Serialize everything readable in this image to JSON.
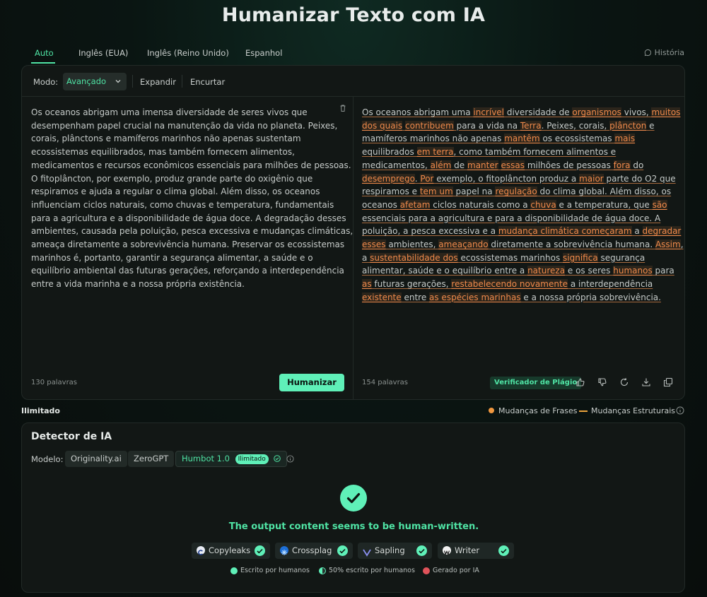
{
  "page": {
    "title": "Humanizar Texto com IA"
  },
  "tabs": [
    {
      "label": "Auto",
      "active": true
    },
    {
      "label": "Inglês (EUA)"
    },
    {
      "label": "Inglês (Reino Unido)"
    },
    {
      "label": "Espanhol"
    }
  ],
  "history_label": "História",
  "toolbar": {
    "mode_label": "Modo:",
    "mode_value": "Avançado",
    "expand_label": "Expandir",
    "shorten_label": "Encurtar"
  },
  "input": {
    "lines": [
      "Os oceanos abrigam uma imensa diversidade de seres vivos que",
      "desempenham papel crucial na manutenção da vida no planeta. Peixes,",
      "corais, plânctons e mamíferos marinhos não apenas sustentam",
      "ecossistemas equilibrados, mas também fornecem alimentos,",
      "medicamentos e recursos econômicos essenciais para milhões de pessoas.",
      "O fitoplâncton, por exemplo, produz grande parte do oxigênio que",
      "respiramos e ajuda a regular o clima global. Além disso, os oceanos",
      "influenciam ciclos naturais, como chuvas e temperatura, fundamentais",
      "para a agricultura e a disponibilidade de água doce. A degradação desses",
      "ambientes, causada pela poluição, pesca excessiva e mudanças climáticas,",
      "ameaça diretamente a sobrevivência humana. Preservar os ecossistemas",
      "marinhos é, portanto, garantir a segurança alimentar, a saúde e o",
      "equilíbrio ambiental das futuras gerações, reforçando a interdependência",
      "entre a vida marinha e a nossa própria existência."
    ],
    "word_count": "130 palavras",
    "humanize_label": "Humanizar"
  },
  "output": {
    "lines": [
      [
        [
          "Os oceanos abrigam uma ",
          0
        ],
        [
          "incrível",
          1
        ],
        [
          " diversidade de ",
          0
        ],
        [
          "organismos",
          1
        ],
        [
          " vivos, ",
          0
        ],
        [
          "muitos",
          1
        ]
      ],
      [
        [
          "dos quais",
          1
        ],
        [
          " ",
          0
        ],
        [
          "contribuem",
          1
        ],
        [
          " para a vida na ",
          0
        ],
        [
          "Terra",
          1
        ],
        [
          ". Peixes, corais, ",
          0
        ],
        [
          "plâncton",
          1
        ],
        [
          " e",
          0
        ]
      ],
      [
        [
          "mamíferos marinhos não apenas ",
          0
        ],
        [
          "mantêm",
          1
        ],
        [
          " os ecossistemas ",
          0
        ],
        [
          "mais",
          1
        ]
      ],
      [
        [
          "equilibrados ",
          0
        ],
        [
          "em terra",
          1
        ],
        [
          ", como também fornecem alimentos e",
          0
        ]
      ],
      [
        [
          "medicamentos, ",
          0
        ],
        [
          "além",
          1
        ],
        [
          " de ",
          0
        ],
        [
          "manter",
          1
        ],
        [
          " ",
          0
        ],
        [
          "essas",
          1
        ],
        [
          " milhões de pessoas ",
          0
        ],
        [
          "fora",
          1
        ],
        [
          " do",
          0
        ]
      ],
      [
        [
          "desemprego",
          1
        ],
        [
          ". ",
          0
        ],
        [
          "Por",
          1
        ],
        [
          " exemplo, o fitoplâncton produz a ",
          0
        ],
        [
          "maior",
          1
        ],
        [
          " parte do O2 que",
          0
        ]
      ],
      [
        [
          "respiramos e ",
          0
        ],
        [
          "tem um",
          1
        ],
        [
          " papel na ",
          0
        ],
        [
          "regulação",
          1
        ],
        [
          " do clima global. Além disso, os",
          0
        ]
      ],
      [
        [
          "oceanos ",
          0
        ],
        [
          "afetam",
          1
        ],
        [
          " ciclos naturais como a ",
          0
        ],
        [
          "chuva",
          1
        ],
        [
          " e a temperatura, que ",
          0
        ],
        [
          "são",
          1
        ]
      ],
      [
        [
          "essenciais para a agricultura e para a disponibilidade de água doce. A",
          0
        ]
      ],
      [
        [
          "poluição, a pesca excessiva e a ",
          0
        ],
        [
          "mudança climática começaram",
          1
        ],
        [
          " a ",
          0
        ],
        [
          "degradar",
          1
        ]
      ],
      [
        [
          "esses",
          1
        ],
        [
          " ambientes, ",
          0
        ],
        [
          "ameaçando",
          1
        ],
        [
          " diretamente a sobrevivência humana. ",
          0
        ],
        [
          "Assim",
          1
        ],
        [
          ",",
          0
        ]
      ],
      [
        [
          "a ",
          0
        ],
        [
          "sustentabilidade dos",
          1
        ],
        [
          " ecossistemas marinhos ",
          0
        ],
        [
          "significa",
          1
        ],
        [
          " segurança",
          0
        ]
      ],
      [
        [
          "alimentar, saúde e o equilíbrio entre a ",
          0
        ],
        [
          "natureza",
          1
        ],
        [
          " e os seres ",
          0
        ],
        [
          "humanos",
          1
        ],
        [
          " para",
          0
        ]
      ],
      [
        [
          "as",
          1
        ],
        [
          " futuras gerações, ",
          0
        ],
        [
          "restabelecendo novamente",
          1
        ],
        [
          " a interdependência",
          0
        ]
      ],
      [
        [
          "existente",
          1
        ],
        [
          " entre ",
          0
        ],
        [
          "as espécies marinhas",
          1
        ],
        [
          " e a nossa própria sobrevivência.",
          0
        ]
      ]
    ],
    "word_count": "154 palavras",
    "plagiarism_label": "Verificador de Plágio"
  },
  "legend": {
    "unlimited": "Ilimitado",
    "phrase_changes": "Mudanças de Frases",
    "structural_changes": "Mudanças Estruturais"
  },
  "detector": {
    "title": "Detector de IA",
    "model_label": "Modelo:",
    "models": [
      "Originality.ai",
      "ZeroGPT",
      "Humbot 1.0"
    ],
    "active_badge": "Ilimitado",
    "verdict": "The output content seems to be human-written.",
    "checkers": [
      "Copyleaks",
      "Crossplag",
      "Sapling",
      "Writer"
    ],
    "key": [
      "Escrito por humanos",
      "50% escrito por humanos",
      "Gerado por IA"
    ]
  },
  "colors": {
    "accent": "#4fe3a4",
    "button": "#5ff0b8",
    "phrase_change": "#f08a4b",
    "structural_change": "#e9a33c",
    "ai_generated": "#e0535a"
  }
}
